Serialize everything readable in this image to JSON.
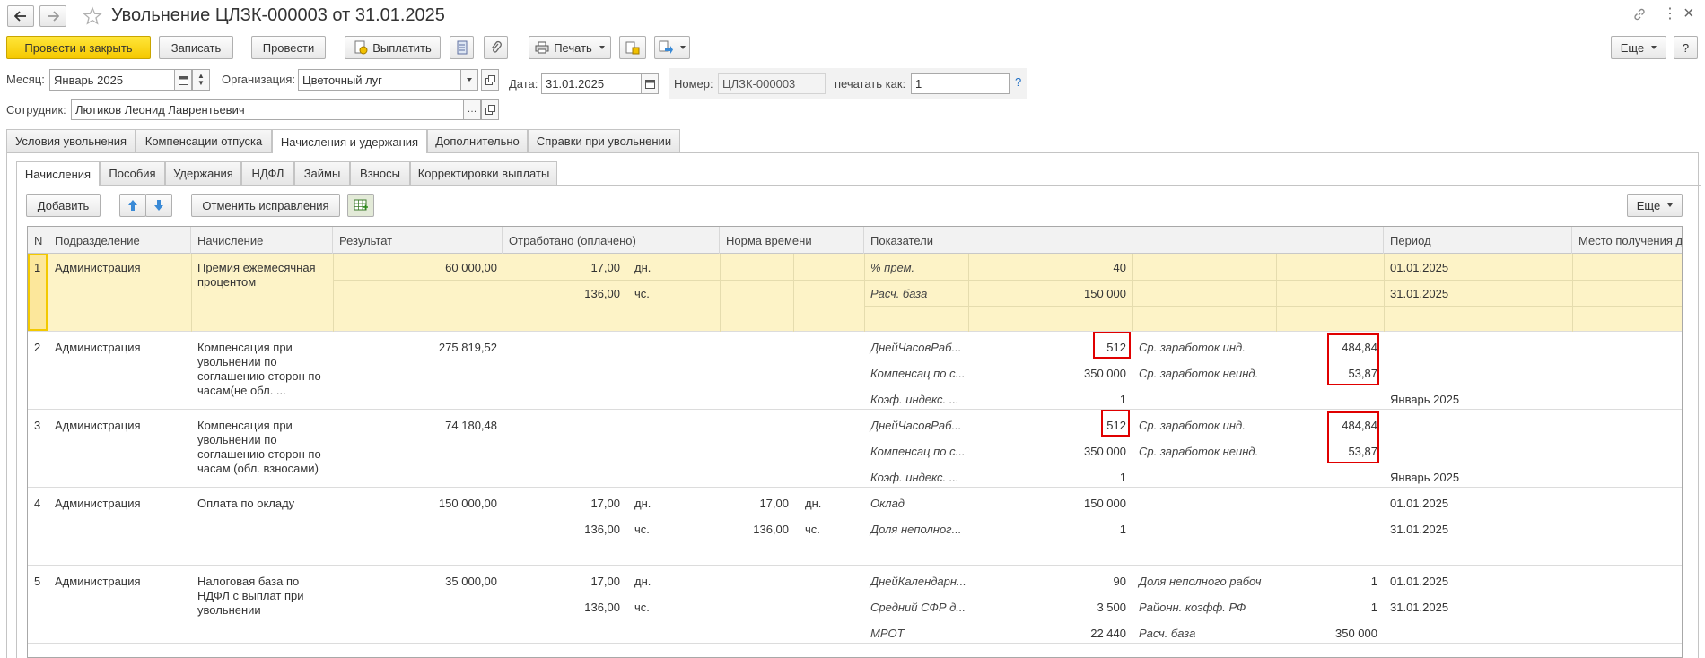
{
  "window": {
    "title": "Увольнение ЦЛЗК-000003 от 31.01.2025"
  },
  "toolbar": {
    "post_close": "Провести и закрыть",
    "save": "Записать",
    "post": "Провести",
    "pay": "Выплатить",
    "print": "Печать",
    "more": "Еще",
    "help": "?"
  },
  "form": {
    "month_label": "Месяц:",
    "month_value": "Январь 2025",
    "org_label": "Организация:",
    "org_value": "Цветочный луг",
    "date_label": "Дата:",
    "date_value": "31.01.2025",
    "number_label": "Номер:",
    "number_value": "ЦЛЗК-000003",
    "print_as_label": "печатать как:",
    "print_as_value": "1",
    "employee_label": "Сотрудник:",
    "employee_value": "Лютиков Леонид Лаврентьевич",
    "hint": "?"
  },
  "tabs": [
    "Условия увольнения",
    "Компенсации отпуска",
    "Начисления и удержания",
    "Дополнительно",
    "Справки при увольнении"
  ],
  "subtabs": [
    "Начисления",
    "Пособия",
    "Удержания",
    "НДФЛ",
    "Займы",
    "Взносы",
    "Корректировки выплаты"
  ],
  "subtoolbar": {
    "add": "Добавить",
    "cancel_fix": "Отменить исправления",
    "more": "Еще"
  },
  "columns": [
    "N",
    "Подразделение",
    "Начисление",
    "Результат",
    "Отработано (оплачено)",
    "Норма времени",
    "Показатели",
    "",
    "Период",
    "Место получения д"
  ],
  "rows": [
    {
      "n": "1",
      "dept": "Администрация",
      "accrual": "Премия ежемесячная процентом",
      "result": "60 000,00",
      "worked": [
        {
          "v": "17,00",
          "u": "дн."
        },
        {
          "v": "136,00",
          "u": "чс."
        }
      ],
      "norm": [],
      "ind": [
        {
          "name": "% прем.",
          "val": "40"
        },
        {
          "name": "Расч. база",
          "val": "150 000"
        }
      ],
      "ind2": [],
      "period": [
        "01.01.2025",
        "31.01.2025"
      ]
    },
    {
      "n": "2",
      "dept": "Администрация",
      "accrual": "Компенсация при увольнении по соглашению сторон по часам(не обл. ...",
      "result": "275 819,52",
      "worked": [],
      "norm": [],
      "ind": [
        {
          "name": "ДнейЧасовРаб...",
          "val": "512"
        },
        {
          "name": "Компенсац по с...",
          "val": "350 000"
        },
        {
          "name": "Коэф. индекс. ...",
          "val": "1"
        }
      ],
      "ind2": [
        {
          "name": "Ср. заработок инд.",
          "val": "484,84"
        },
        {
          "name": "Ср. заработок неинд.",
          "val": "53,87"
        }
      ],
      "period": [
        "",
        "",
        "Январь 2025"
      ]
    },
    {
      "n": "3",
      "dept": "Администрация",
      "accrual": "Компенсация при увольнении по соглашению сторон по часам (обл. взносами)",
      "result": "74 180,48",
      "worked": [],
      "norm": [],
      "ind": [
        {
          "name": "ДнейЧасовРаб...",
          "val": "512"
        },
        {
          "name": "Компенсац по с...",
          "val": "350 000"
        },
        {
          "name": "Коэф. индекс. ...",
          "val": "1"
        }
      ],
      "ind2": [
        {
          "name": "Ср. заработок инд.",
          "val": "484,84"
        },
        {
          "name": "Ср. заработок неинд.",
          "val": "53,87"
        }
      ],
      "period": [
        "",
        "",
        "Январь 2025"
      ]
    },
    {
      "n": "4",
      "dept": "Администрация",
      "accrual": "Оплата по окладу",
      "result": "150 000,00",
      "worked": [
        {
          "v": "17,00",
          "u": "дн."
        },
        {
          "v": "136,00",
          "u": "чс."
        }
      ],
      "norm": [
        {
          "v": "17,00",
          "u": "дн."
        },
        {
          "v": "136,00",
          "u": "чс."
        }
      ],
      "ind": [
        {
          "name": "Оклад",
          "val": "150 000"
        },
        {
          "name": "Доля неполног...",
          "val": "1"
        }
      ],
      "ind2": [],
      "period": [
        "01.01.2025",
        "31.01.2025"
      ]
    },
    {
      "n": "5",
      "dept": "Администрация",
      "accrual": "Налоговая база по НДФЛ с выплат при увольнении",
      "result": "35 000,00",
      "worked": [
        {
          "v": "17,00",
          "u": "дн."
        },
        {
          "v": "136,00",
          "u": "чс."
        }
      ],
      "norm": [],
      "ind": [
        {
          "name": "ДнейКалендарн...",
          "val": "90"
        },
        {
          "name": "Средний СФР д...",
          "val": "3 500"
        },
        {
          "name": "МРОТ",
          "val": "22 440"
        }
      ],
      "ind2": [
        {
          "name": "Доля неполного рабоч",
          "val": "1"
        },
        {
          "name": "Районн. коэфф. РФ",
          "val": "1"
        },
        {
          "name": "Расч. база",
          "val": "350 000"
        }
      ],
      "period": [
        "01.01.2025",
        "31.01.2025"
      ]
    }
  ],
  "colors": {
    "primary_button": "#f5c800",
    "selected_row": "#fdf3c7",
    "highlight": "#e00000"
  }
}
